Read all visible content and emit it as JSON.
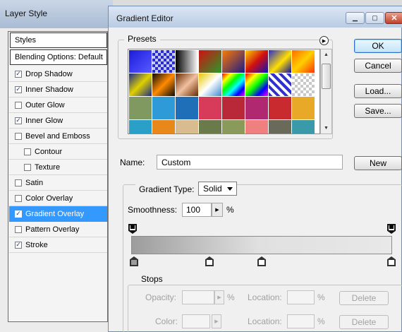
{
  "layer_style": {
    "title": "Layer Style",
    "header": "Styles",
    "blending": "Blending Options: Default",
    "items": [
      {
        "label": "Drop Shadow",
        "checked": true,
        "selected": false,
        "indent": false
      },
      {
        "label": "Inner Shadow",
        "checked": true,
        "selected": false,
        "indent": false
      },
      {
        "label": "Outer Glow",
        "checked": false,
        "selected": false,
        "indent": false
      },
      {
        "label": "Inner Glow",
        "checked": true,
        "selected": false,
        "indent": false
      },
      {
        "label": "Bevel and Emboss",
        "checked": false,
        "selected": false,
        "indent": false
      },
      {
        "label": "Contour",
        "checked": false,
        "selected": false,
        "indent": true
      },
      {
        "label": "Texture",
        "checked": false,
        "selected": false,
        "indent": true
      },
      {
        "label": "Satin",
        "checked": false,
        "selected": false,
        "indent": false
      },
      {
        "label": "Color Overlay",
        "checked": false,
        "selected": false,
        "indent": false
      },
      {
        "label": "Gradient Overlay",
        "checked": true,
        "selected": true,
        "indent": false
      },
      {
        "label": "Pattern Overlay",
        "checked": false,
        "selected": false,
        "indent": false
      },
      {
        "label": "Stroke",
        "checked": true,
        "selected": false,
        "indent": false
      }
    ]
  },
  "gradient_editor": {
    "title": "Gradient Editor",
    "window_buttons": {
      "minimize": "▁",
      "maximize": "▢",
      "close": "✕"
    },
    "presets_label": "Presets",
    "buttons": {
      "ok": "OK",
      "cancel": "Cancel",
      "load": "Load...",
      "save": "Save...",
      "new": "New"
    },
    "name_label": "Name:",
    "name_value": "Custom",
    "gradient_type_label": "Gradient Type:",
    "gradient_type_value": "Solid",
    "smoothness_label": "Smoothness:",
    "smoothness_value": "100",
    "smoothness_unit": "%",
    "stops_label": "Stops",
    "opacity_label": "Opacity:",
    "color_label": "Color:",
    "location_label": "Location:",
    "percent": "%",
    "delete_label": "Delete",
    "gradient_colors": [
      "#9c9c9c",
      "#c6c6c6",
      "#e0e0e0",
      "#e8e8e8"
    ]
  },
  "presets": [
    "linear-gradient(135deg,#1b1bd6,#3a3af0 50%,#5a5aff)",
    "repeating-conic-gradient(#2a2ad0 0 25%, #bfc8ff 0 50%) 0 0/8px 8px",
    "linear-gradient(90deg,#000,#fff)",
    "linear-gradient(135deg,#d01010,#2a9a2a)",
    "linear-gradient(135deg,#ff7a00,#1a1a8a)",
    "linear-gradient(135deg,#ffd000,#d01010 50%,#1010c0)",
    "linear-gradient(135deg,#2a2ad0,#ffe000 55%,#1010a0)",
    "linear-gradient(135deg,#ff6a00,#ffd000 50%,#ff3300)",
    "linear-gradient(135deg,#1a2a8a,#e0d000 50%,#1a2a8a)",
    "linear-gradient(135deg,#0a0a0a,#ff8a00 50%,#0a0a0a)",
    "linear-gradient(135deg,#6a2a00,#f0c0a0 50%,#6a2a00)",
    "linear-gradient(135deg,#e8c800,#fff 50%,#3a8ad0)",
    "linear-gradient(135deg,#ff0000,#ffff00 20%,#00ff00 40%,#00ffff 60%,#0000ff 80%,#ff00ff)",
    "linear-gradient(135deg,#ff0000,#ffff00 25%,#00ff00 50%,#0000ff 75%,#ff00ff)",
    "repeating-linear-gradient(45deg,#3030d0 0 4px,#fff 4px 8px)",
    "repeating-conic-gradient(#c8c8c8 0 25%, #fff 0 50%) 0 0/8px 8px",
    "#7f9960",
    "#2f9ad8",
    "#1f6fb8",
    "#d83a5a",
    "#b82838",
    "#b02870",
    "#c82a30",
    "#e8a828",
    "#2aa0c8",
    "#e8881a",
    "#d8bc90",
    "#6a7a4a",
    "#8a9a5a",
    "#f08080",
    "#6a6a5a",
    "#3a9aaa"
  ]
}
